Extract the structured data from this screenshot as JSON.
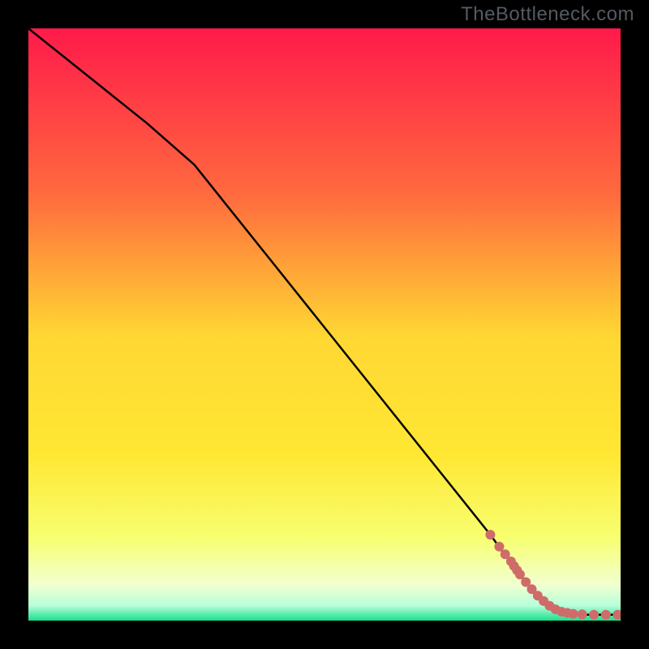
{
  "attribution": "TheBottleneck.com",
  "colors": {
    "top": "#ff1a4b",
    "upper_mid": "#ff7a3a",
    "mid": "#ffd733",
    "lower_mid": "#f7ff70",
    "pale": "#f1ffd0",
    "bottom": "#18e08a",
    "line": "#000000",
    "marker": "#cf6c69"
  },
  "chart_data": {
    "type": "line",
    "xlim": [
      0,
      100
    ],
    "ylim": [
      0,
      100
    ],
    "grid": false,
    "legend": false,
    "xlabel": "",
    "ylabel": "",
    "title": "",
    "series": [
      {
        "name": "bottleneck-curve",
        "x": [
          0,
          10,
          20,
          28,
          40,
          50,
          60,
          70,
          78,
          82,
          86,
          90,
          94,
          100
        ],
        "y": [
          100,
          92,
          84,
          77,
          62,
          49.5,
          37,
          24.5,
          14.5,
          9,
          4,
          1.5,
          1,
          1
        ]
      }
    ],
    "markers": {
      "name": "highlight-dots",
      "x": [
        78,
        79.5,
        80.5,
        81.5,
        82,
        82.5,
        83,
        84,
        85,
        86,
        87,
        88,
        89,
        90,
        91,
        92,
        93.5,
        95.5,
        97.5,
        99.5
      ],
      "y": [
        14.5,
        12.5,
        11.2,
        10,
        9.2,
        8.5,
        7.8,
        6.5,
        5.3,
        4.2,
        3.3,
        2.5,
        1.9,
        1.5,
        1.3,
        1.15,
        1.05,
        1.0,
        1.0,
        1.0
      ]
    }
  }
}
